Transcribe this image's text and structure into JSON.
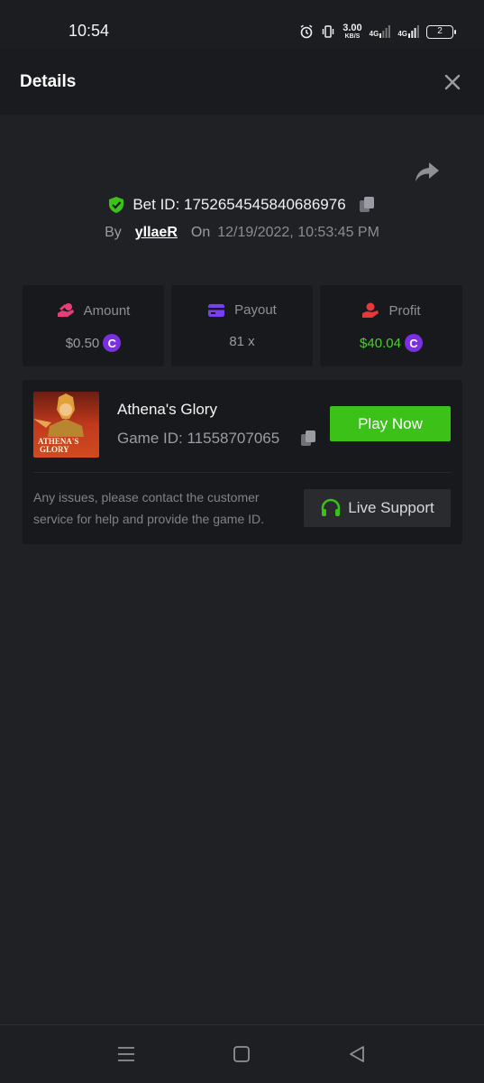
{
  "status_bar": {
    "time": "10:54",
    "speed_value": "3.00",
    "speed_unit": "KB/S",
    "net1": "4G",
    "net2": "4G",
    "battery": "2"
  },
  "header": {
    "title": "Details"
  },
  "bet": {
    "bet_id_label": "Bet ID: 1752654545840686976",
    "by_label": "By",
    "username": "yllaeR",
    "on_label": "On",
    "date": "12/19/2022, 10:53:45 PM"
  },
  "stats": {
    "amount": {
      "label": "Amount",
      "value": "$0.50"
    },
    "payout": {
      "label": "Payout",
      "value": "81 x"
    },
    "profit": {
      "label": "Profit",
      "value": "$40.04"
    }
  },
  "coin_symbol": "C",
  "game": {
    "name": "Athena's Glory",
    "game_id_label": "Game ID: 11558707065",
    "play_label": "Play Now",
    "help_text": "Any issues, please contact the customer service for help and provide the game ID.",
    "support_label": "Live Support",
    "thumb_text_line1": "ATHENA'S",
    "thumb_text_line2": "GLORY"
  },
  "colors": {
    "background": "#202124",
    "accent_green": "#3bc117",
    "profit_green": "#48d12a",
    "coin_purple": "#7b2fe0",
    "amount_pink": "#e83e78",
    "payout_purple": "#7b3ff2",
    "profit_red": "#e5383b"
  },
  "icons": [
    "alarm-icon",
    "vibrate-icon",
    "signal-icon",
    "battery-icon",
    "close-icon",
    "share-icon",
    "shield-check-icon",
    "copy-icon",
    "hand-coin-icon",
    "card-icon",
    "hand-money-icon",
    "coin-icon",
    "headset-icon",
    "menu-icon",
    "home-square-icon",
    "back-triangle-icon"
  ]
}
